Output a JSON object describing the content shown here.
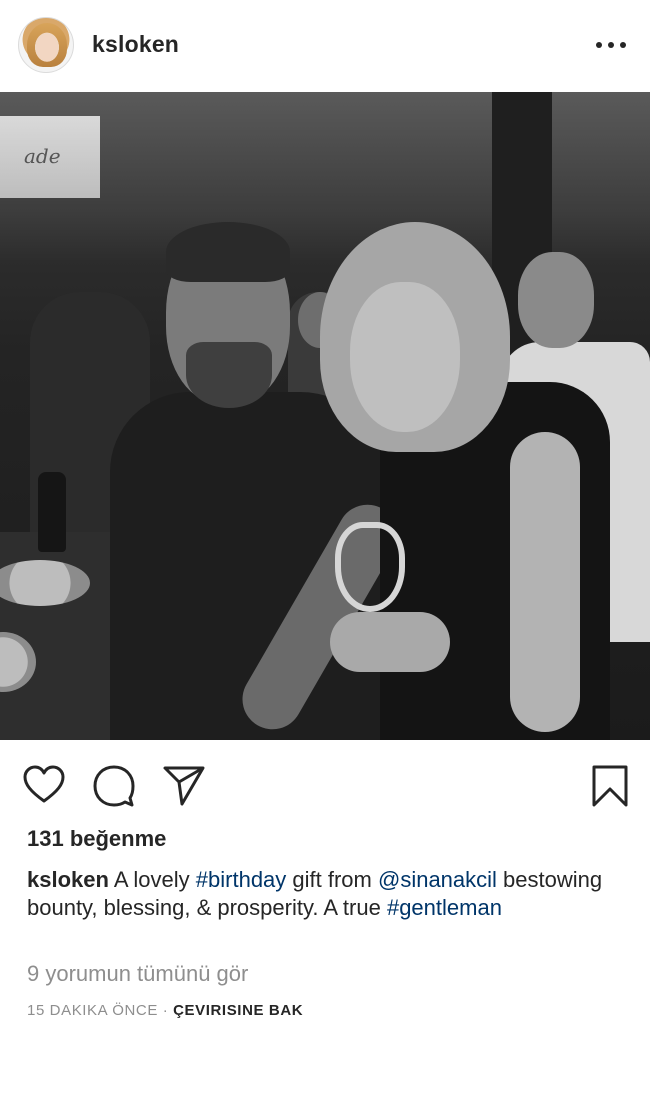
{
  "post": {
    "username": "ksloken",
    "more_icon": "more-horizontal-icon",
    "likes_text": "131 beğenme",
    "caption": {
      "username": "ksloken",
      "parts": {
        "p1": " A lovely ",
        "tag1": "#birthday",
        "p2": " gift from ",
        "mention": "@sinanakcil",
        "p3": " bestowing bounty, blessing, & prosperity. A true ",
        "tag2": "#gentleman"
      }
    },
    "view_comments": "9 yorumun tümünü gör",
    "time": "15 DAKIKA ÖNCE",
    "separator": " · ",
    "translate": "ÇEVIRISINE BAK"
  },
  "actions": {
    "like_icon": "heart-icon",
    "comment_icon": "comment-bubble-icon",
    "share_icon": "paper-plane-icon",
    "save_icon": "bookmark-icon"
  },
  "photo": {
    "sign_text": "ade"
  },
  "colors": {
    "text": "#262626",
    "secondary": "#8e8e8e",
    "link": "#003569"
  }
}
